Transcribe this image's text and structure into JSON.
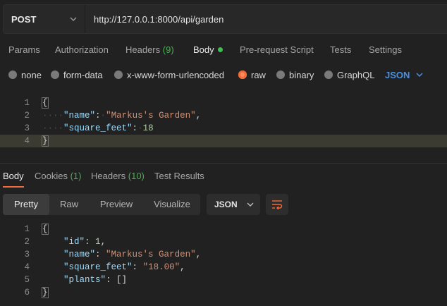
{
  "request": {
    "method": "POST",
    "url": "http://127.0.0.1:8000/api/garden"
  },
  "request_tabs": [
    {
      "label": "Params"
    },
    {
      "label": "Authorization"
    },
    {
      "label": "Headers",
      "count": "(9)"
    },
    {
      "label": "Body",
      "active": true
    },
    {
      "label": "Pre-request Script"
    },
    {
      "label": "Tests"
    },
    {
      "label": "Settings"
    }
  ],
  "body_types": [
    {
      "label": "none"
    },
    {
      "label": "form-data"
    },
    {
      "label": "x-www-form-urlencoded"
    },
    {
      "label": "raw",
      "selected": true
    },
    {
      "label": "binary"
    },
    {
      "label": "GraphQL"
    }
  ],
  "body_format": "JSON",
  "request_body": {
    "line_numbers": [
      "1",
      "2",
      "3",
      "4"
    ],
    "open_brace": "{",
    "close_brace": "}",
    "name_key": "\"name\"",
    "name_value": "\"Markus's Garden\"",
    "sqft_key": "\"square_feet\"",
    "sqft_value": "18"
  },
  "response_tabs": [
    {
      "label": "Body",
      "active": true
    },
    {
      "label": "Cookies",
      "count": "(1)"
    },
    {
      "label": "Headers",
      "count": "(10)"
    },
    {
      "label": "Test Results"
    }
  ],
  "view_modes": [
    {
      "label": "Pretty",
      "active": true
    },
    {
      "label": "Raw"
    },
    {
      "label": "Preview"
    },
    {
      "label": "Visualize"
    }
  ],
  "response_format": "JSON",
  "response_body": {
    "line_numbers": [
      "1",
      "2",
      "3",
      "4",
      "5",
      "6"
    ],
    "open_brace": "{",
    "close_brace": "}",
    "id_key": "\"id\"",
    "id_value": "1",
    "name_key": "\"name\"",
    "name_value": "\"Markus's Garden\"",
    "sqft_key": "\"square_feet\"",
    "sqft_value": "\"18.00\"",
    "plants_key": "\"plants\"",
    "plants_value": "[]"
  },
  "colors": {
    "accent": "#f26b3a",
    "link": "#4a90e2",
    "status_green": "#4caf50"
  }
}
